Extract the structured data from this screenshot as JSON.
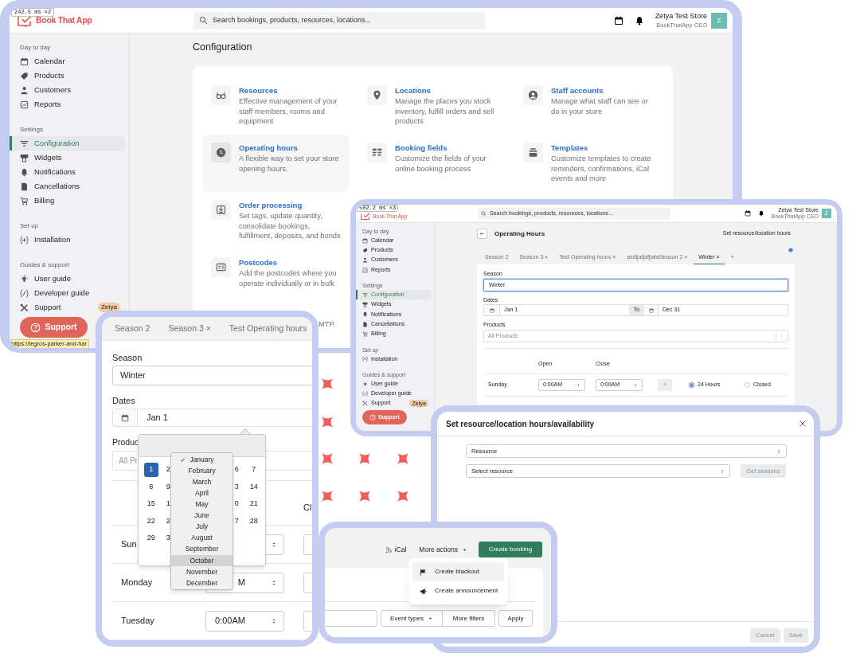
{
  "config_window": {
    "debug_label": "242.5 ms ×2",
    "header": {
      "logo": "Book That App",
      "search_placeholder": "Search bookings, products, resources, locations...",
      "user_name": "Zetya Test Store",
      "user_role": "BookThatApp CEO",
      "avatar": "Z"
    },
    "sidebar": [
      {
        "heading": "Day to day",
        "items": [
          {
            "label": "Calendar",
            "selected": false
          },
          {
            "label": "Products",
            "selected": false
          },
          {
            "label": "Customers",
            "selected": false
          },
          {
            "label": "Reports",
            "selected": false
          }
        ]
      },
      {
        "heading": "Settings",
        "items": [
          {
            "label": "Configuration",
            "selected": true
          },
          {
            "label": "Widgets",
            "selected": false
          },
          {
            "label": "Notifications",
            "selected": false
          },
          {
            "label": "Cancellations",
            "selected": false
          },
          {
            "label": "Billing",
            "selected": false
          }
        ]
      },
      {
        "heading": "Set up",
        "items": [
          {
            "label": "Installation",
            "selected": false
          }
        ]
      },
      {
        "heading": "Guides & support",
        "items": [
          {
            "label": "User guide",
            "selected": false
          },
          {
            "label": "Developer guide",
            "selected": false
          },
          {
            "label": "Support",
            "selected": false,
            "badge": "Zetya"
          }
        ]
      }
    ],
    "support_button": "Support",
    "status_url": "https://legros-parker-and-har",
    "title": "Configuration",
    "settings_rows": [
      [
        {
          "title": "Resources",
          "description": "Effective management of your staff members, rooms and equipment",
          "highlighted": false
        },
        {
          "title": "Locations",
          "description": "Manage the places you stock inventory, fulfill orders and sell products",
          "highlighted": false
        },
        {
          "title": "Staff accounts",
          "description": "Manage what staff can see or do in your store",
          "highlighted": false
        }
      ],
      [
        {
          "title": "Operating hours",
          "description": "A flexible way to set your store opening hours.",
          "highlighted": true
        },
        {
          "title": "Booking fields",
          "description": "Customize the fields of your online booking process",
          "highlighted": false
        },
        {
          "title": "Templates",
          "description": "Customize templates to create reminders, confirmations, iCal events and more",
          "highlighted": false
        }
      ],
      [
        {
          "title": "Order processing",
          "description": "Set tags, update quantity, consolidate bookings, fulfillment, deposits, and bonds",
          "highlighted": false
        }
      ],
      [
        {
          "title": "Postcodes",
          "description": "Add the postcodes where you operate individually or in bulk",
          "highlighted": false
        }
      ]
    ],
    "hidden_item_fragment": "MTP,"
  },
  "hours_window": {
    "debug_label": "502.2 ms ×3",
    "header": {
      "logo": "Book That App",
      "search_placeholder": "Search bookings, products, resources, locations...",
      "user_name": "Zetya Test Store",
      "user_role": "BookThatApp CEO",
      "avatar": "Z"
    },
    "sidebar": [
      {
        "heading": "Day to day",
        "items": [
          {
            "label": "Calendar",
            "selected": false
          },
          {
            "label": "Products",
            "selected": false
          },
          {
            "label": "Customers",
            "selected": false
          },
          {
            "label": "Reports",
            "selected": false
          }
        ]
      },
      {
        "heading": "Settings",
        "items": [
          {
            "label": "Configuration",
            "selected": true
          },
          {
            "label": "Widgets",
            "selected": false
          },
          {
            "label": "Notifications",
            "selected": false
          },
          {
            "label": "Cancellations",
            "selected": false
          },
          {
            "label": "Billing",
            "selected": false
          }
        ]
      },
      {
        "heading": "Set up",
        "items": [
          {
            "label": "Installation",
            "selected": false
          }
        ]
      },
      {
        "heading": "Guides & support",
        "items": [
          {
            "label": "User guide",
            "selected": false
          },
          {
            "label": "Developer guide",
            "selected": false
          },
          {
            "label": "Support",
            "selected": false,
            "badge": "Zetya"
          }
        ]
      }
    ],
    "support_button": "Support",
    "title": "Operating Hours",
    "link": "Set resource/location hours",
    "tabs": [
      {
        "label": "Season 2",
        "selected": false
      },
      {
        "label": "Season 3 ×",
        "selected": false
      },
      {
        "label": "Test Operating hours ×",
        "selected": false
      },
      {
        "label": "asdijafjafjlafaSeason 2 ×",
        "selected": false
      },
      {
        "label": "Winter ×",
        "selected": true
      }
    ],
    "add_tab": "+",
    "form": {
      "season_label": "Season",
      "season_value": "Winter",
      "dates_label": "Dates",
      "date_from": "Jan 1",
      "date_separator": "To",
      "date_to": "Dec 31",
      "products_label": "Products",
      "products_placeholder": "All Products",
      "columns": [
        "Open",
        "Close"
      ],
      "days": [
        {
          "day": "Sunday",
          "open": "0:00AM",
          "close": "0:00AM",
          "add": "+",
          "options": [
            {
              "label": "24 Hours",
              "selected": true
            },
            {
              "label": "Closed",
              "selected": false
            }
          ]
        }
      ]
    }
  },
  "zoom_window": {
    "tabs": [
      {
        "label": "Season 2",
        "selected": false
      },
      {
        "label": "Season 3 ×",
        "selected": false
      },
      {
        "label": "Test Operating hours",
        "selected": false
      }
    ],
    "season_label": "Season",
    "season_value": "Winter",
    "dates_label": "Dates",
    "date_from": "Jan 1",
    "products_label": "Produc",
    "products_placeholder": "All Pr",
    "columns": [
      "Cl"
    ],
    "days": [
      {
        "day": "Sun"
      },
      {
        "day": "Monday",
        "open": "M"
      },
      {
        "day": "Tuesday",
        "open": "0:00AM"
      }
    ],
    "date_picker": {
      "weeks": [
        {
          "left": [
            {
              "label": "1",
              "selected": true
            },
            {
              "label": "2",
              "selected": false
            }
          ],
          "right": [
            {
              "label": "6",
              "selected": false
            },
            {
              "label": "7",
              "selected": false
            }
          ]
        },
        {
          "left": [
            {
              "label": "8",
              "selected": false
            },
            {
              "label": "9",
              "selected": false
            }
          ],
          "right": [
            {
              "label": "3",
              "selected": false
            },
            {
              "label": "14",
              "selected": false
            }
          ]
        },
        {
          "left": [
            {
              "label": "15",
              "selected": false
            },
            {
              "label": "1",
              "selected": false
            }
          ],
          "right": [
            {
              "label": "0",
              "selected": false
            },
            {
              "label": "21",
              "selected": false
            }
          ]
        },
        {
          "left": [
            {
              "label": "22",
              "selected": false
            },
            {
              "label": "2",
              "selected": false
            }
          ],
          "right": [
            {
              "label": "7",
              "selected": false
            },
            {
              "label": "28",
              "selected": false
            }
          ]
        },
        {
          "left": [
            {
              "label": "29",
              "selected": false
            },
            {
              "label": "3",
              "selected": false
            }
          ]
        }
      ],
      "months": [
        {
          "label": "January",
          "checked": true,
          "highlighted": false
        },
        {
          "label": "February",
          "checked": false,
          "highlighted": false
        },
        {
          "label": "March",
          "checked": false,
          "highlighted": false
        },
        {
          "label": "April",
          "checked": false,
          "highlighted": false
        },
        {
          "label": "May",
          "checked": false,
          "highlighted": false
        },
        {
          "label": "June",
          "checked": false,
          "highlighted": false
        },
        {
          "label": "July",
          "checked": false,
          "highlighted": false
        },
        {
          "label": "August",
          "checked": false,
          "highlighted": false
        },
        {
          "label": "September",
          "checked": false,
          "highlighted": false
        },
        {
          "label": "October",
          "checked": false,
          "highlighted": true
        },
        {
          "label": "November",
          "checked": false,
          "highlighted": false
        },
        {
          "label": "December",
          "checked": false,
          "highlighted": false
        }
      ]
    }
  },
  "modal": {
    "title": "Set resource/location hours/availability",
    "type_select": "Resource",
    "resource_select": "Select resource",
    "side_button": {
      "label": "Get seasons",
      "disabled": true
    },
    "footer_buttons": [
      {
        "label": "Cancel",
        "disabled": true
      },
      {
        "label": "Save",
        "disabled": true
      }
    ]
  },
  "actions_window": {
    "ical": "iCal",
    "more_actions": "More actions",
    "primary_button": "Create booking",
    "menu": [
      {
        "label": "Create blackout",
        "highlighted": true
      },
      {
        "label": "Create announcement",
        "highlighted": false
      }
    ],
    "filters": [
      "Event types",
      "More filters",
      "Apply"
    ]
  }
}
